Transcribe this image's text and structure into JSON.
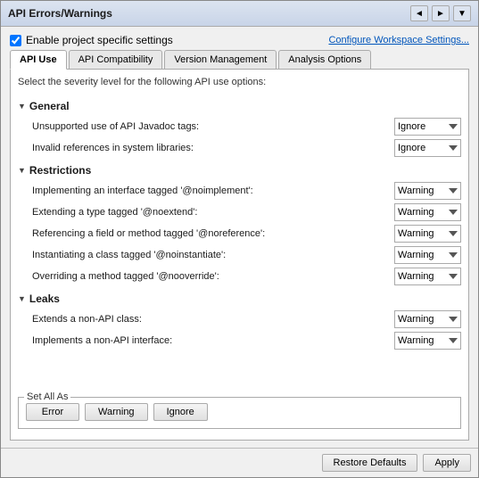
{
  "window": {
    "title": "API Errors/Warnings"
  },
  "header": {
    "checkbox_label": "Enable project specific settings",
    "workspace_link": "Configure Workspace Settings..."
  },
  "tabs": [
    {
      "id": "api-use",
      "label": "API Use",
      "active": true
    },
    {
      "id": "api-compatibility",
      "label": "API Compatibility",
      "active": false
    },
    {
      "id": "version-management",
      "label": "Version Management",
      "active": false
    },
    {
      "id": "analysis-options",
      "label": "Analysis Options",
      "active": false
    }
  ],
  "tab_content": {
    "description": "Select the severity level for the following API use options:",
    "sections": [
      {
        "id": "general",
        "label": "General",
        "items": [
          {
            "id": "unsupported-javadoc",
            "label": "Unsupported use of API Javadoc tags:",
            "value": "Ignore"
          },
          {
            "id": "invalid-references",
            "label": "Invalid references in system libraries:",
            "value": "Ignore"
          }
        ]
      },
      {
        "id": "restrictions",
        "label": "Restrictions",
        "items": [
          {
            "id": "noimplement",
            "label": "Implementing an interface tagged '@noimplement':",
            "value": "Warning"
          },
          {
            "id": "noextend",
            "label": "Extending a type tagged '@noextend':",
            "value": "Warning"
          },
          {
            "id": "noreference",
            "label": "Referencing a field or method tagged '@noreference':",
            "value": "Warning"
          },
          {
            "id": "noinstantiate",
            "label": "Instantiating a class tagged '@noinstantiate':",
            "value": "Warning"
          },
          {
            "id": "nooverride",
            "label": "Overriding a method tagged '@nooverride':",
            "value": "Warning"
          }
        ]
      },
      {
        "id": "leaks",
        "label": "Leaks",
        "items": [
          {
            "id": "non-api-class",
            "label": "Extends a non-API class:",
            "value": "Warning"
          },
          {
            "id": "non-api-interface",
            "label": "Implements a non-API interface:",
            "value": "Warning"
          }
        ]
      }
    ]
  },
  "set_all_as": {
    "label": "Set All As",
    "buttons": [
      {
        "id": "error",
        "label": "Error"
      },
      {
        "id": "warning",
        "label": "Warning"
      },
      {
        "id": "ignore",
        "label": "Ignore"
      }
    ]
  },
  "dropdown_options": [
    "Error",
    "Warning",
    "Ignore"
  ],
  "bottom_buttons": [
    {
      "id": "restore-defaults",
      "label": "Restore Defaults"
    },
    {
      "id": "apply",
      "label": "Apply"
    }
  ],
  "icons": {
    "back": "◄",
    "forward": "►",
    "dropdown_arrow": "▼",
    "triangle_open": "▼",
    "checkbox_checked": "☑"
  }
}
